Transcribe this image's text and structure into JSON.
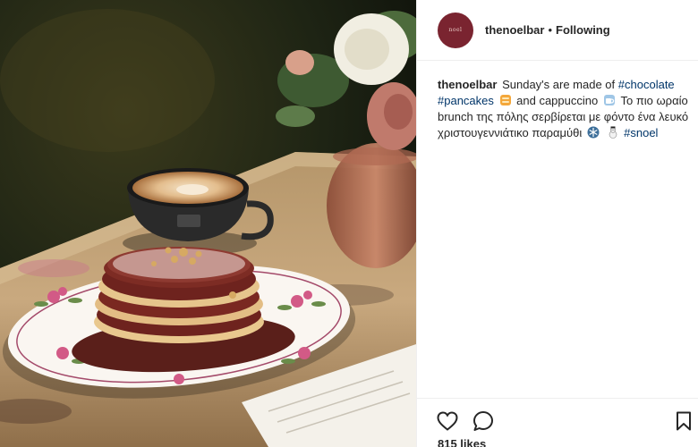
{
  "post": {
    "photo_alt": "",
    "header": {
      "username": "thenoelbar",
      "separator": "•",
      "follow_status": "Following"
    },
    "caption": {
      "username": "thenoelbar",
      "text_1": "Sunday's are made of",
      "tag_chocolate": "#chocolate",
      "tag_pancakes": "#pancakes",
      "text_2": "and cappuccino",
      "text_3": "Το πιο ωραίο brunch της πόλης σερβίρεται με φόντο ένα λευκό χριστουγεννιάτικο παραμύθι",
      "tag_snoel": "#snoel"
    },
    "icons": {
      "like": "heart-icon",
      "comment": "comment-bubble-icon",
      "save": "bookmark-icon",
      "pancake_emoji": "pancakes-emoji",
      "coffee_emoji": "coffee-emoji",
      "snowflake_emoji": "snowflake-emoji",
      "snowman_emoji": "snowman-emoji"
    },
    "likes": "815 likes",
    "colors": {
      "hashtag": "#003569",
      "text": "#262626",
      "divider": "#efefef",
      "avatar": "#7a2430"
    }
  }
}
